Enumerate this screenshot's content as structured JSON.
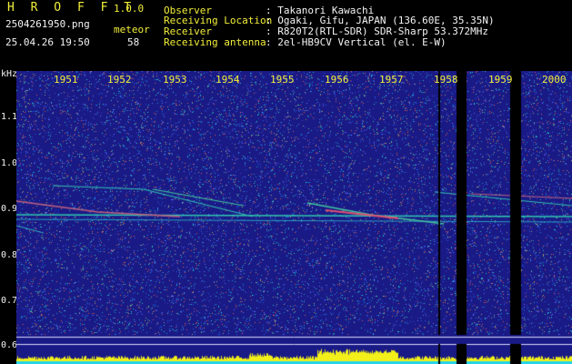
{
  "header": {
    "app_title": "H R O F F T",
    "version": "1.0.0",
    "filename": "2504261950.png",
    "datetime": "25.04.26 19:50",
    "count_label": "meteor",
    "count_value": "58",
    "observer_label": "Observer",
    "observer_value": ": Takanori Kawachi",
    "location_label": "Receiving Location",
    "location_value": ": Ogaki, Gifu, JAPAN (136.60E, 35.35N)",
    "receiver_label": "Receiver",
    "receiver_value": ": R820T2(RTL-SDR) SDR-Sharp 53.372MHz",
    "antenna_label": "Receiving antenna",
    "antenna_value": ": 2el-HB9CV Vertical (el. E-W)"
  },
  "y_axis": {
    "unit": "kHz",
    "ticks": [
      "1.1",
      "1.0",
      "0.9",
      "0.8",
      "0.7",
      "0.6"
    ]
  },
  "time_axis": {
    "ticks": [
      "1951",
      "1952",
      "1953",
      "1954",
      "1955",
      "1956",
      "1957",
      "1958",
      "1959",
      "2000"
    ]
  },
  "colors": {
    "text_primary": "#f2ef3a",
    "text_secondary": "#f4f4f4",
    "spectrum_background": "#1a1a86",
    "level_bar": "#f2ef1a",
    "baseline": "#27d3e8"
  }
}
